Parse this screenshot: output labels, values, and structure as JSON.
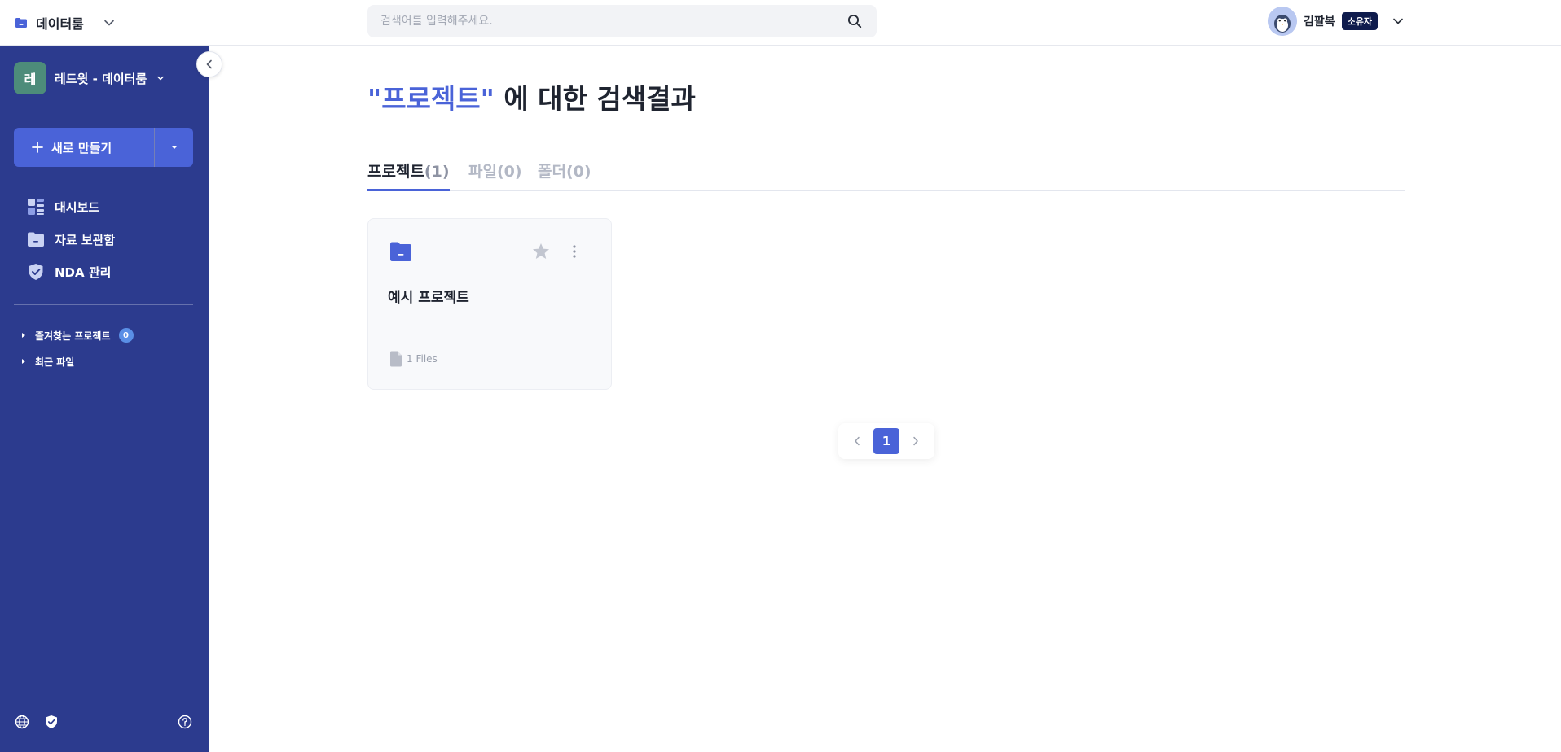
{
  "topbar": {
    "app_name": "데이터룸",
    "search_placeholder": "검색어를 입력해주세요.",
    "user_name": "김팔복",
    "user_role": "소유자"
  },
  "sidebar": {
    "workspace_initial": "레",
    "workspace_name": "레드윗 - 데이터룸",
    "new_button_label": "새로 만들기",
    "nav": [
      {
        "label": "대시보드",
        "icon": "dashboard-icon"
      },
      {
        "label": "자료 보관함",
        "icon": "folder-icon"
      },
      {
        "label": "NDA 관리",
        "icon": "shield-check-icon"
      }
    ],
    "tree": [
      {
        "label": "즐겨찾는 프로젝트",
        "count": "0"
      },
      {
        "label": "최근 파일"
      }
    ],
    "footer_icons": [
      "globe-icon",
      "shield-check-icon",
      "help-icon"
    ]
  },
  "main": {
    "headline_query": "\"프로젝트\"",
    "headline_rest": "에 대한 검색결과",
    "tabs": [
      {
        "label": "프로젝트",
        "count": "(1)",
        "active": true
      },
      {
        "label": "파일",
        "count": "(0)",
        "active": false
      },
      {
        "label": "폴더",
        "count": "(0)",
        "active": false
      }
    ],
    "cards": [
      {
        "title": "예시 프로젝트",
        "files": "1 Files"
      }
    ],
    "pagination": {
      "current": "1"
    }
  },
  "colors": {
    "sidebar_bg": "#2c3b8e",
    "accent": "#4a63d8",
    "workspace_icon_bg": "#4d8c7a",
    "role_badge_bg": "#0f1c4d"
  }
}
